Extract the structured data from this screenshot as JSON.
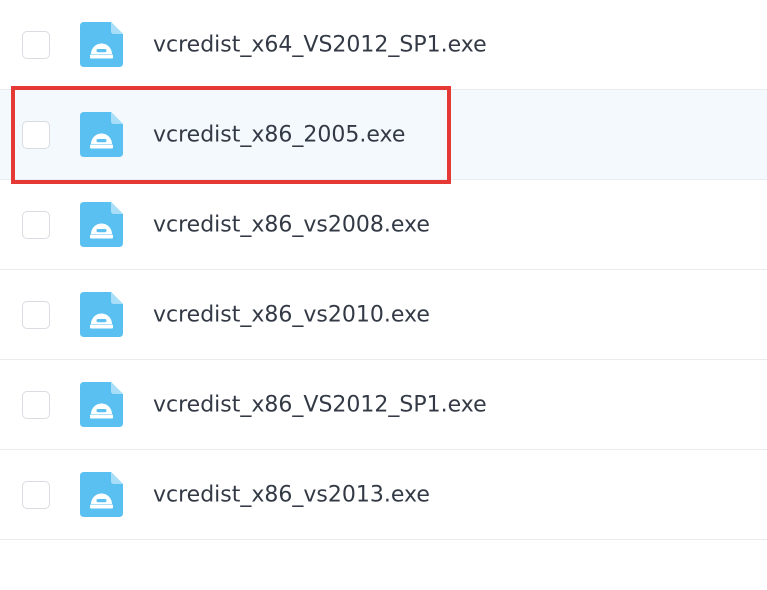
{
  "files": [
    {
      "name": "vcredist_x64_VS2012_SP1.exe",
      "icon": "exe-file-icon",
      "highlighted": false
    },
    {
      "name": "vcredist_x86_2005.exe",
      "icon": "exe-file-icon",
      "highlighted": true
    },
    {
      "name": "vcredist_x86_vs2008.exe",
      "icon": "exe-file-icon",
      "highlighted": false
    },
    {
      "name": "vcredist_x86_vs2010.exe",
      "icon": "exe-file-icon",
      "highlighted": false
    },
    {
      "name": "vcredist_x86_VS2012_SP1.exe",
      "icon": "exe-file-icon",
      "highlighted": false
    },
    {
      "name": "vcredist_x86_vs2013.exe",
      "icon": "exe-file-icon",
      "highlighted": false
    }
  ],
  "colors": {
    "icon_fill": "#5ac0f2",
    "icon_fold": "#a9def8",
    "selection_border": "#e53935",
    "highlight_row": "#f4f9fd"
  }
}
